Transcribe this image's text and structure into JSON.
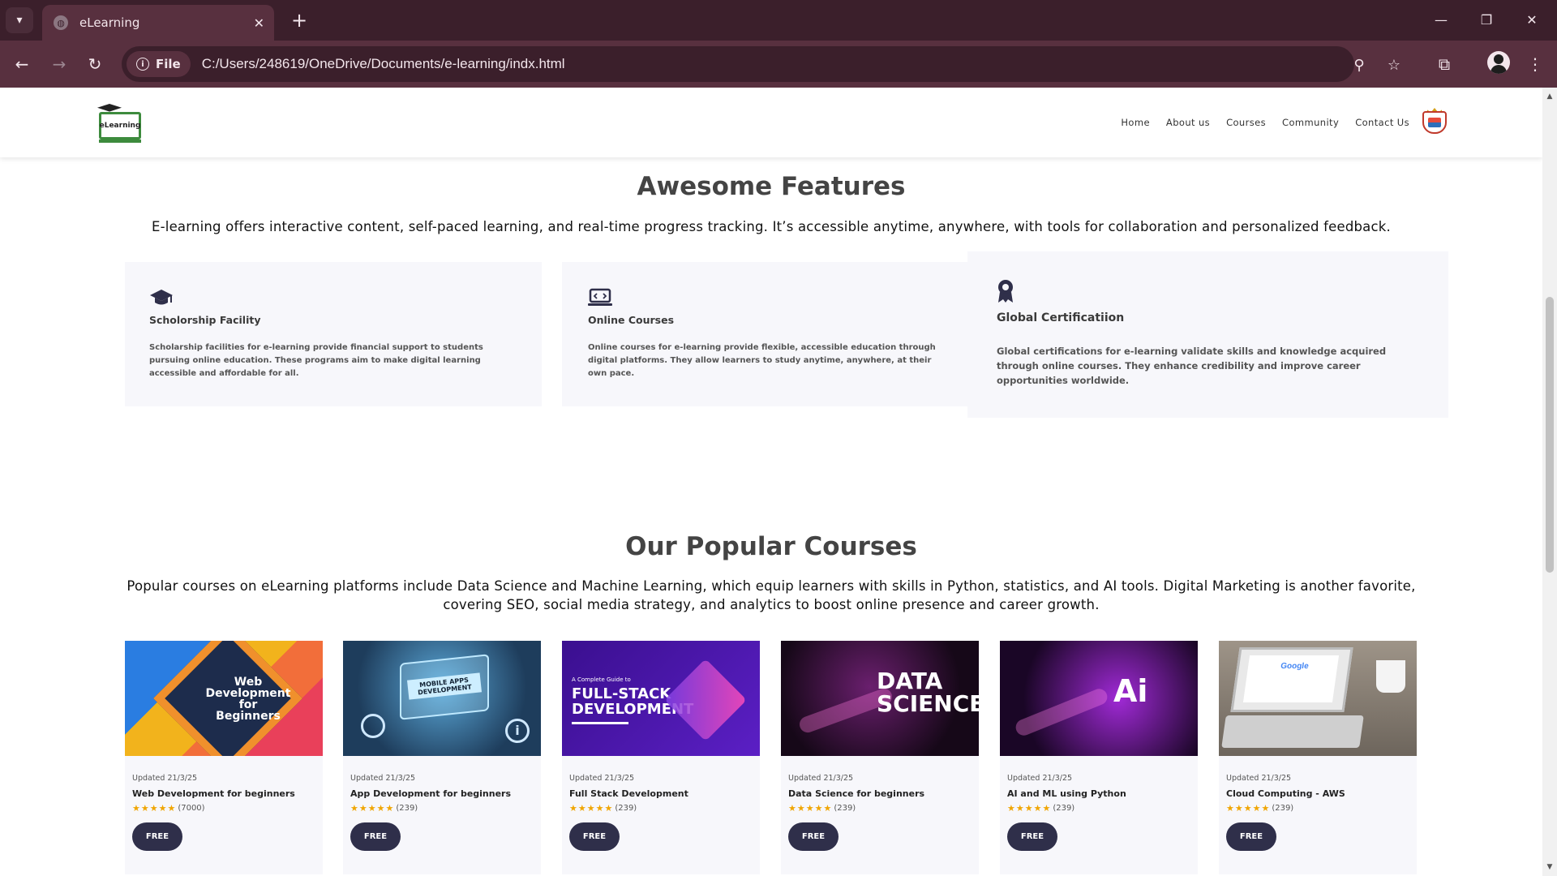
{
  "browser": {
    "tab_title": "eLearning",
    "chip_label": "File",
    "url": "C:/Users/248619/OneDrive/Documents/e-learning/indx.html"
  },
  "header": {
    "logo_text": "eLearning",
    "nav": [
      "Home",
      "About us",
      "Courses",
      "Community",
      "Contact Us"
    ]
  },
  "features_section": {
    "title": "Awesome Features",
    "description": "E-learning offers interactive content, self-paced learning, and real-time progress tracking. It’s accessible anytime, anywhere, with tools for collaboration and personalized feedback.",
    "items": [
      {
        "icon": "graduation-cap-icon",
        "title": "Scholorship Facility",
        "text": "Scholarship facilities for e-learning provide financial support to students pursuing online education. These programs aim to make digital learning accessible and affordable for all."
      },
      {
        "icon": "laptop-code-icon",
        "title": "Online Courses",
        "text": "Online courses for e-learning provide flexible, accessible education through digital platforms. They allow learners to study anytime, anywhere, at their own pace."
      },
      {
        "icon": "award-icon",
        "title": "Global Certificatiion",
        "text": "Global certifications for e-learning validate skills and knowledge acquired through online courses. They enhance credibility and improve career opportunities worldwide."
      }
    ]
  },
  "courses_section": {
    "title": "Our Popular Courses",
    "description": "Popular courses on eLearning platforms include Data Science and Machine Learning, which equip learners with skills in Python, statistics, and AI tools. Digital Marketing is another favorite, covering SEO, social media strategy, and analytics to boost online presence and career growth.",
    "courses": [
      {
        "updated": "Updated 21/3/25",
        "name": "Web Development for beginners",
        "rating_count": "(7000)",
        "price": "FREE",
        "thumb_text": [
          "Web",
          "Development",
          "for",
          "Beginners"
        ],
        "stars": 5
      },
      {
        "updated": "Updated 21/3/25",
        "name": "App Development for beginners",
        "rating_count": "(239)",
        "price": "FREE",
        "thumb_text": [
          "MOBILE APPS",
          "DEVELOPMENT"
        ],
        "stars": 5
      },
      {
        "updated": "Updated 21/3/25",
        "name": "Full Stack Development",
        "rating_count": "(239)",
        "price": "FREE",
        "thumb_text": [
          "A Complete Guide to",
          "FULL-STACK",
          "DEVELOPMENT"
        ],
        "stars": 5
      },
      {
        "updated": "Updated 21/3/25",
        "name": "Data Science for beginners",
        "rating_count": "(239)",
        "price": "FREE",
        "thumb_text": [
          "DATA",
          "SCIENCE"
        ],
        "stars": 5
      },
      {
        "updated": "Updated 21/3/25",
        "name": "AI and ML using Python",
        "rating_count": "(239)",
        "price": "FREE",
        "thumb_text": [
          "Ai"
        ],
        "stars": 5
      },
      {
        "updated": "Updated 21/3/25",
        "name": "Cloud Computing - AWS",
        "rating_count": "(239)",
        "price": "FREE",
        "thumb_text": [
          "Google"
        ],
        "stars": 5
      }
    ]
  }
}
